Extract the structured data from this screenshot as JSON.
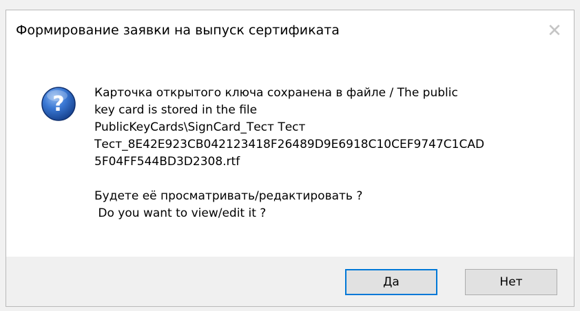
{
  "dialog": {
    "title": "Формирование заявки на выпуск сертификата",
    "close_icon": "close-icon",
    "icon": "question-icon",
    "message_lines": [
      "Карточка открытого ключа сохранена в файле / The public",
      "key card is stored in the file",
      "PublicKeyCards\\SignCard_Тест Тест",
      "Тест_8E42E923CB042123418F26489D9E6918C10CEF9747C1CAD",
      "5F04FF544BD3D2308.rtf"
    ],
    "question_lines": [
      "Будете её просматривать/редактировать ?",
      " Do you want to view/edit it ?"
    ],
    "buttons": {
      "yes_label": "Да",
      "no_label": "Нет"
    },
    "colors": {
      "accent": "#0078d7",
      "footer_bg": "#f0f0f0",
      "icon_blue": "#1f5fbf"
    }
  }
}
